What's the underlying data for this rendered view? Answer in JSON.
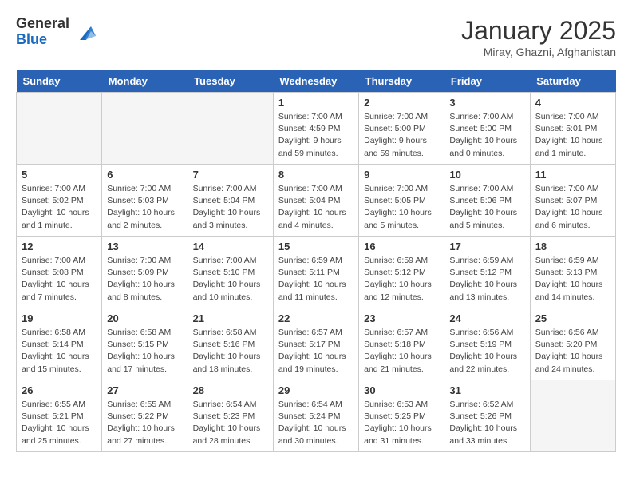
{
  "logo": {
    "general": "General",
    "blue": "Blue"
  },
  "header": {
    "month": "January 2025",
    "location": "Miray, Ghazni, Afghanistan"
  },
  "weekdays": [
    "Sunday",
    "Monday",
    "Tuesday",
    "Wednesday",
    "Thursday",
    "Friday",
    "Saturday"
  ],
  "weeks": [
    [
      {
        "day": "",
        "info": ""
      },
      {
        "day": "",
        "info": ""
      },
      {
        "day": "",
        "info": ""
      },
      {
        "day": "1",
        "info": "Sunrise: 7:00 AM\nSunset: 4:59 PM\nDaylight: 9 hours\nand 59 minutes."
      },
      {
        "day": "2",
        "info": "Sunrise: 7:00 AM\nSunset: 5:00 PM\nDaylight: 9 hours\nand 59 minutes."
      },
      {
        "day": "3",
        "info": "Sunrise: 7:00 AM\nSunset: 5:00 PM\nDaylight: 10 hours\nand 0 minutes."
      },
      {
        "day": "4",
        "info": "Sunrise: 7:00 AM\nSunset: 5:01 PM\nDaylight: 10 hours\nand 1 minute."
      }
    ],
    [
      {
        "day": "5",
        "info": "Sunrise: 7:00 AM\nSunset: 5:02 PM\nDaylight: 10 hours\nand 1 minute."
      },
      {
        "day": "6",
        "info": "Sunrise: 7:00 AM\nSunset: 5:03 PM\nDaylight: 10 hours\nand 2 minutes."
      },
      {
        "day": "7",
        "info": "Sunrise: 7:00 AM\nSunset: 5:04 PM\nDaylight: 10 hours\nand 3 minutes."
      },
      {
        "day": "8",
        "info": "Sunrise: 7:00 AM\nSunset: 5:04 PM\nDaylight: 10 hours\nand 4 minutes."
      },
      {
        "day": "9",
        "info": "Sunrise: 7:00 AM\nSunset: 5:05 PM\nDaylight: 10 hours\nand 5 minutes."
      },
      {
        "day": "10",
        "info": "Sunrise: 7:00 AM\nSunset: 5:06 PM\nDaylight: 10 hours\nand 5 minutes."
      },
      {
        "day": "11",
        "info": "Sunrise: 7:00 AM\nSunset: 5:07 PM\nDaylight: 10 hours\nand 6 minutes."
      }
    ],
    [
      {
        "day": "12",
        "info": "Sunrise: 7:00 AM\nSunset: 5:08 PM\nDaylight: 10 hours\nand 7 minutes."
      },
      {
        "day": "13",
        "info": "Sunrise: 7:00 AM\nSunset: 5:09 PM\nDaylight: 10 hours\nand 8 minutes."
      },
      {
        "day": "14",
        "info": "Sunrise: 7:00 AM\nSunset: 5:10 PM\nDaylight: 10 hours\nand 10 minutes."
      },
      {
        "day": "15",
        "info": "Sunrise: 6:59 AM\nSunset: 5:11 PM\nDaylight: 10 hours\nand 11 minutes."
      },
      {
        "day": "16",
        "info": "Sunrise: 6:59 AM\nSunset: 5:12 PM\nDaylight: 10 hours\nand 12 minutes."
      },
      {
        "day": "17",
        "info": "Sunrise: 6:59 AM\nSunset: 5:12 PM\nDaylight: 10 hours\nand 13 minutes."
      },
      {
        "day": "18",
        "info": "Sunrise: 6:59 AM\nSunset: 5:13 PM\nDaylight: 10 hours\nand 14 minutes."
      }
    ],
    [
      {
        "day": "19",
        "info": "Sunrise: 6:58 AM\nSunset: 5:14 PM\nDaylight: 10 hours\nand 15 minutes."
      },
      {
        "day": "20",
        "info": "Sunrise: 6:58 AM\nSunset: 5:15 PM\nDaylight: 10 hours\nand 17 minutes."
      },
      {
        "day": "21",
        "info": "Sunrise: 6:58 AM\nSunset: 5:16 PM\nDaylight: 10 hours\nand 18 minutes."
      },
      {
        "day": "22",
        "info": "Sunrise: 6:57 AM\nSunset: 5:17 PM\nDaylight: 10 hours\nand 19 minutes."
      },
      {
        "day": "23",
        "info": "Sunrise: 6:57 AM\nSunset: 5:18 PM\nDaylight: 10 hours\nand 21 minutes."
      },
      {
        "day": "24",
        "info": "Sunrise: 6:56 AM\nSunset: 5:19 PM\nDaylight: 10 hours\nand 22 minutes."
      },
      {
        "day": "25",
        "info": "Sunrise: 6:56 AM\nSunset: 5:20 PM\nDaylight: 10 hours\nand 24 minutes."
      }
    ],
    [
      {
        "day": "26",
        "info": "Sunrise: 6:55 AM\nSunset: 5:21 PM\nDaylight: 10 hours\nand 25 minutes."
      },
      {
        "day": "27",
        "info": "Sunrise: 6:55 AM\nSunset: 5:22 PM\nDaylight: 10 hours\nand 27 minutes."
      },
      {
        "day": "28",
        "info": "Sunrise: 6:54 AM\nSunset: 5:23 PM\nDaylight: 10 hours\nand 28 minutes."
      },
      {
        "day": "29",
        "info": "Sunrise: 6:54 AM\nSunset: 5:24 PM\nDaylight: 10 hours\nand 30 minutes."
      },
      {
        "day": "30",
        "info": "Sunrise: 6:53 AM\nSunset: 5:25 PM\nDaylight: 10 hours\nand 31 minutes."
      },
      {
        "day": "31",
        "info": "Sunrise: 6:52 AM\nSunset: 5:26 PM\nDaylight: 10 hours\nand 33 minutes."
      },
      {
        "day": "",
        "info": ""
      }
    ]
  ]
}
